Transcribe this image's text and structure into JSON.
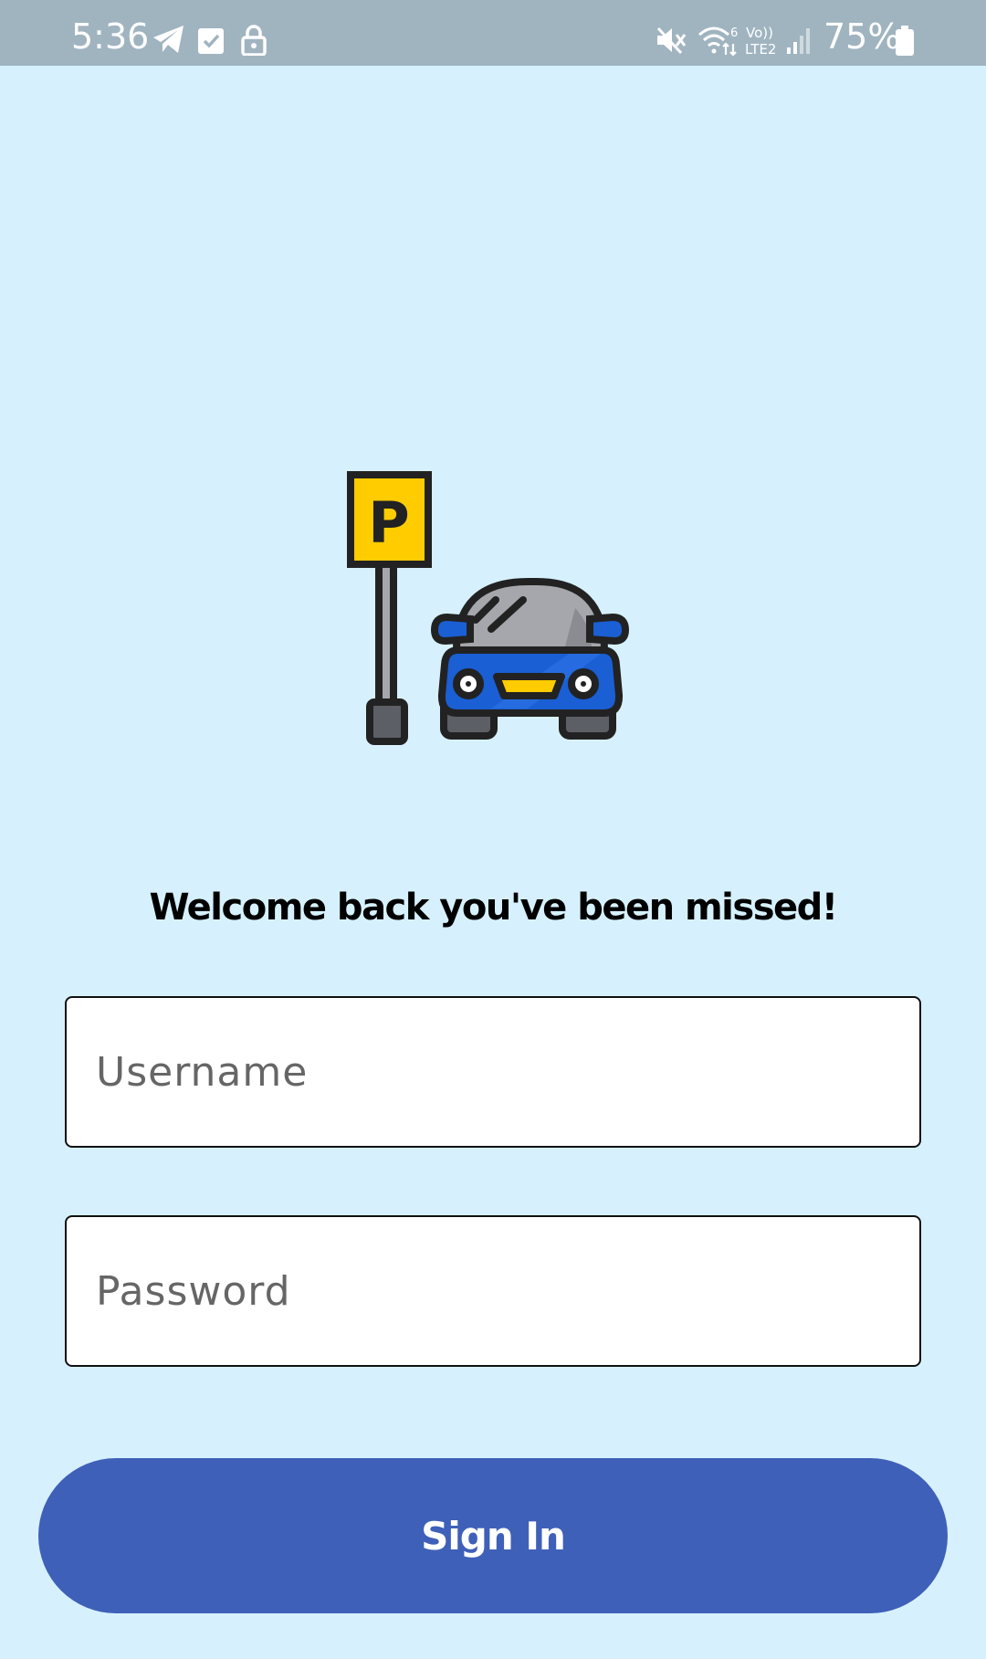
{
  "status_bar": {
    "time": "5:36",
    "battery": "75%",
    "network_label": "Vo)) LTE2",
    "wifi_label": "6",
    "icons": [
      "telegram-icon",
      "check-square-icon",
      "lock-icon",
      "mute-icon",
      "wifi-icon",
      "volte-icon",
      "signal-icon",
      "battery-icon"
    ]
  },
  "hero": {
    "sign_letter": "P",
    "colors": {
      "sign": "#ffcc00",
      "car_body": "#1a5fd4",
      "car_roof": "#a5a7ac",
      "outline": "#222222"
    }
  },
  "welcome_text": "Welcome back you've been missed!",
  "form": {
    "username_placeholder": "Username",
    "password_placeholder": "Password",
    "signin_label": "Sign In"
  },
  "colors": {
    "background": "#d6f1fd",
    "status_bar": "#a0b4c0",
    "button": "#3f60b8"
  }
}
